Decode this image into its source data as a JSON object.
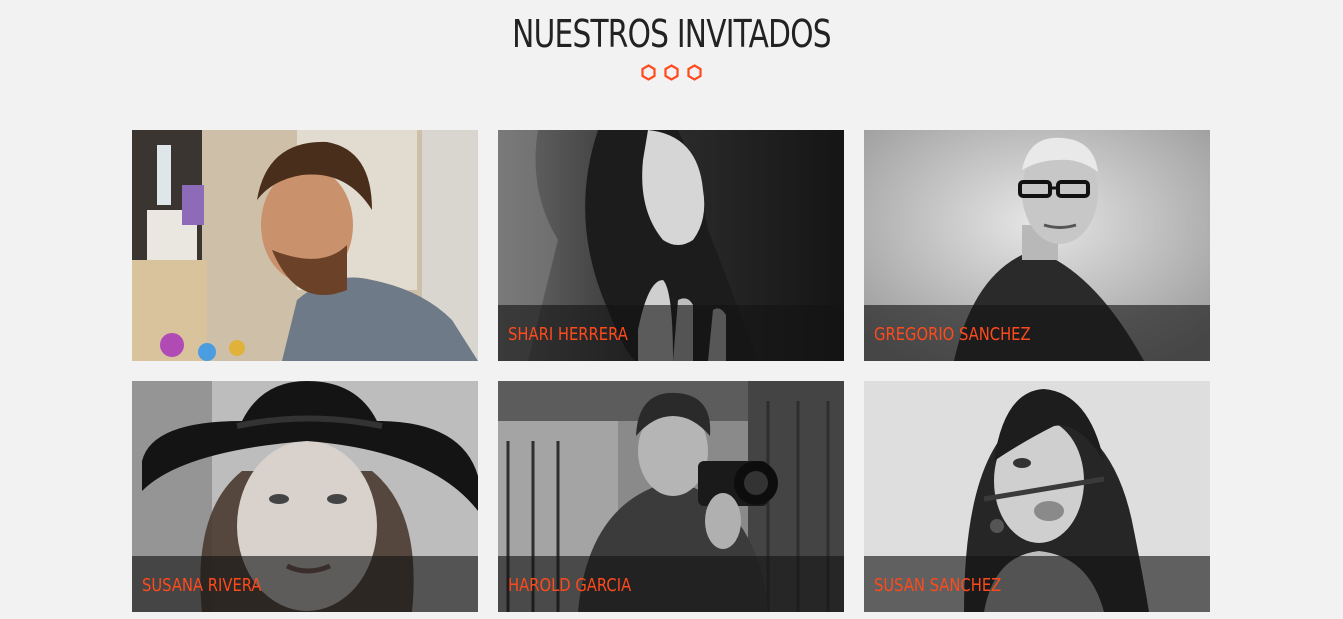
{
  "section": {
    "title": "NUESTROS INVITADOS"
  },
  "accent_color": "#ff4a1c",
  "decoration": {
    "icons": [
      "hexagon-icon",
      "hexagon-icon",
      "hexagon-icon"
    ]
  },
  "guests": [
    {
      "name": "",
      "photo": "man-beard-working-photo"
    },
    {
      "name": "SHARI HERRERA",
      "photo": "woman-profile-photo"
    },
    {
      "name": "GREGORIO SANCHEZ",
      "photo": "man-glasses-photo"
    },
    {
      "name": "SUSANA RIVERA",
      "photo": "woman-hat-photo"
    },
    {
      "name": "HAROLD GARCIA",
      "photo": "man-camera-photo"
    },
    {
      "name": "SUSAN SANCHEZ",
      "photo": "woman-pencil-mustache-photo"
    }
  ]
}
